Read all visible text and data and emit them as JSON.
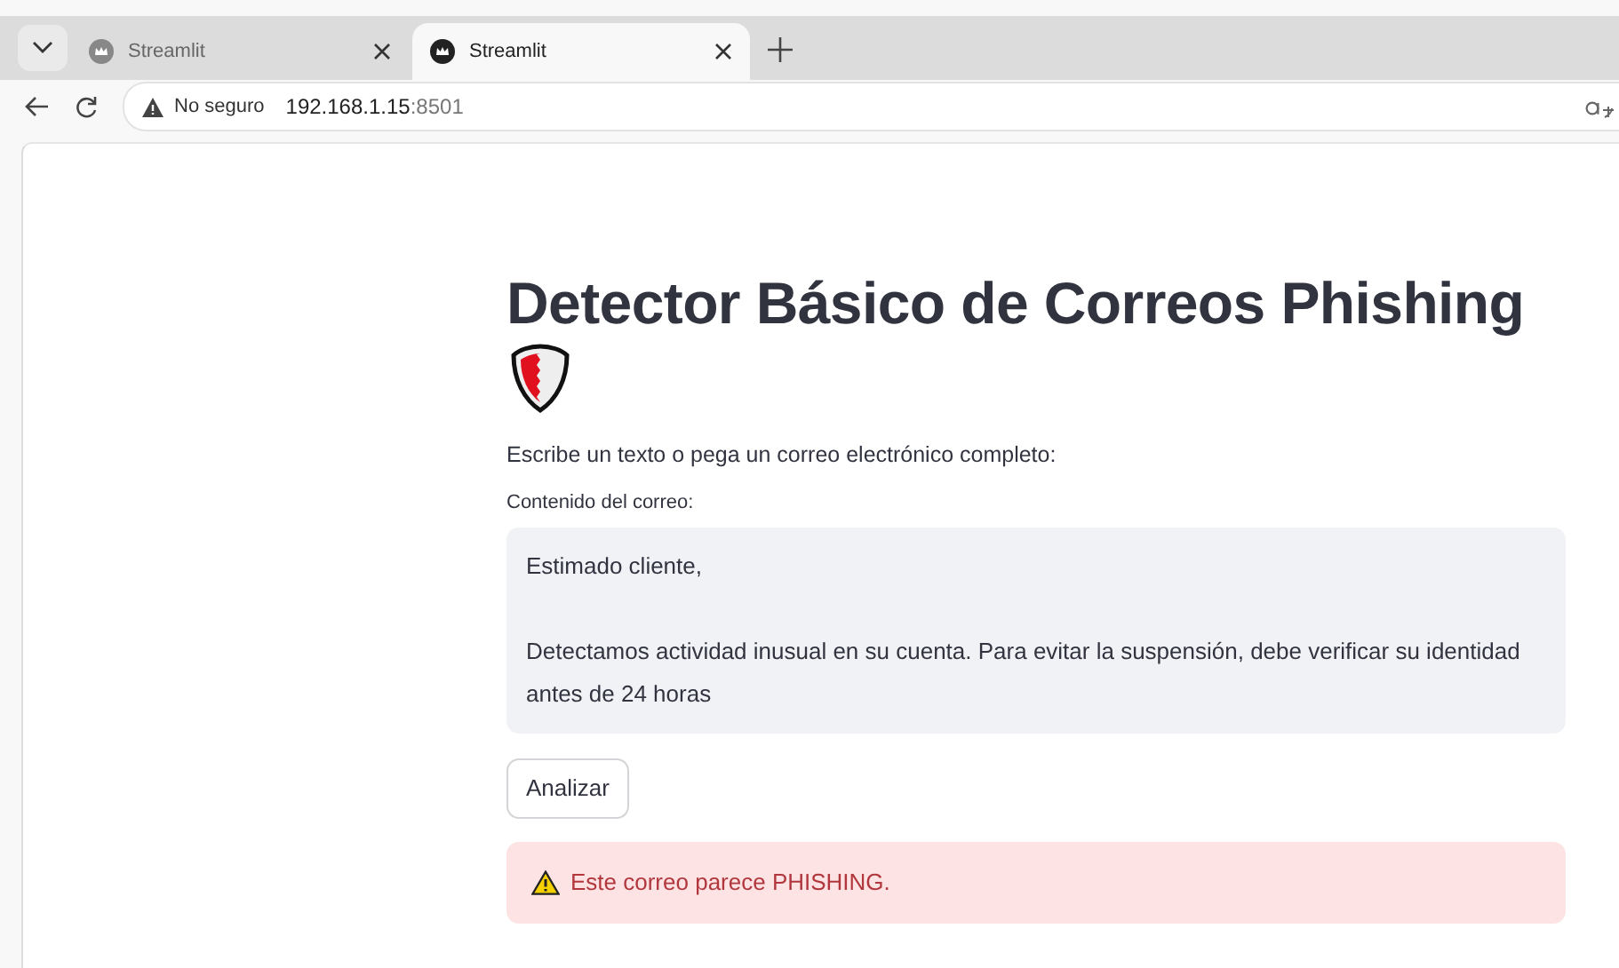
{
  "browser": {
    "tabs": [
      {
        "title": "Streamlit",
        "selected": false
      },
      {
        "title": "Streamlit",
        "selected": true
      }
    ],
    "address": {
      "security": "No seguro",
      "host": "192.168.1.15",
      "port": ":8501"
    }
  },
  "page": {
    "title": "Detector Básico de Correos Phishing",
    "intro": "Escribe un texto o pega un correo electrónico completo:",
    "field_label": "Contenido del correo:",
    "field_value": "Estimado cliente,\n\nDetectamos actividad inusual en su cuenta. Para evitar la suspensión, debe verificar su identidad\nantes de 24 horas",
    "button": "Analizar",
    "alert": {
      "kind": "error",
      "text": "Este correo parece PHISHING."
    }
  }
}
